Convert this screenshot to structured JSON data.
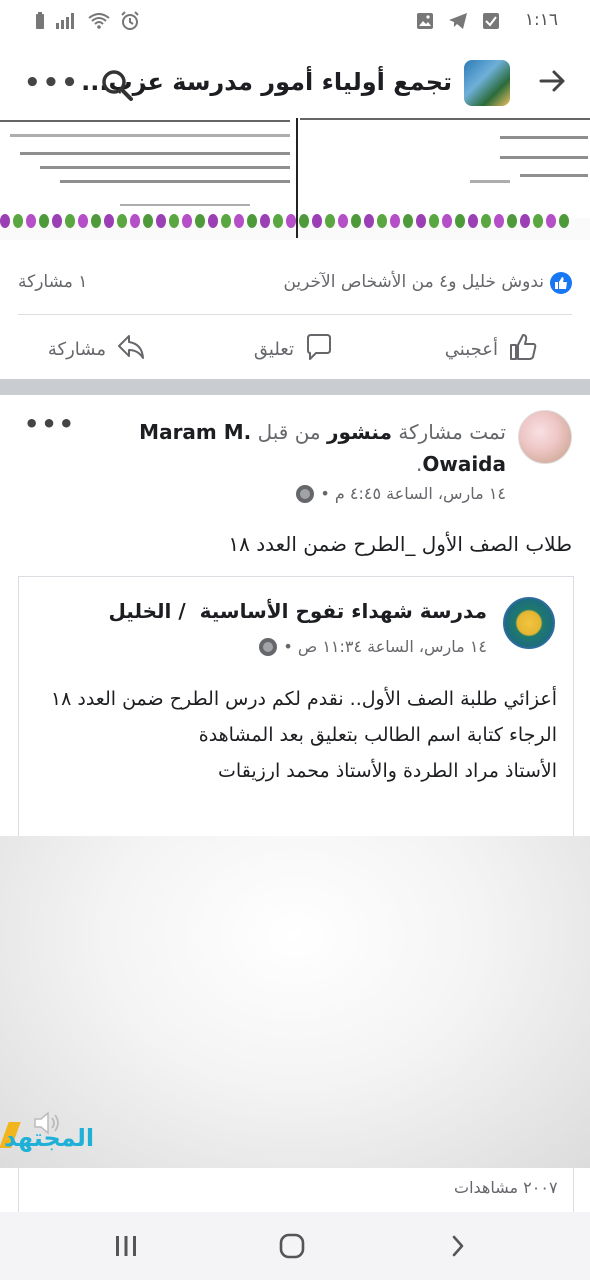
{
  "status_bar": {
    "time": "١:١٦",
    "left_icons": [
      "battery-icon",
      "signal-icon",
      "wifi-icon",
      "alarm-icon"
    ],
    "right_icons": [
      "checkbox-icon",
      "telegram-icon",
      "image-icon"
    ]
  },
  "header": {
    "title": "تجمع أولياء أمور مدرسة عزب...",
    "back_icon": "arrow-right-icon",
    "search_icon": "search-icon",
    "more_icon": "more-icon"
  },
  "previous_post": {
    "reactions_text": "ندوش خليل و٤ من الأشخاص الآخرين",
    "shares": "١ مشاركة",
    "actions": {
      "like": "أعجبني",
      "comment": "تعليق",
      "share": "مشاركة"
    }
  },
  "post": {
    "header_prefix": "تمت مشاركة",
    "header_post_word": "منشور",
    "header_by": "من قبل",
    "author": "Maram M. Owaida",
    "header_suffix": ".",
    "meta": "١٤ مارس، الساعة ٤:٤٥ م •",
    "body": "طلاب الصف الأول _الطرح ضمن العدد ١٨",
    "shared": {
      "page_name": "مدرسة شهداء تفوح الأساسية  / الخليل",
      "meta": "١٤ مارس، الساعة ١١:٣٤ ص •",
      "lines": [
        "أعزائي طلبة الصف الأول.. نقدم لكم درس الطرح ضمن العدد ١٨",
        "الرجاء كتابة اسم الطالب بتعليق بعد المشاهدة",
        "الأستاذ مراد الطردة والأستاذ محمد ارزيقات"
      ],
      "views": "٢٠٠٧ مشاهدات",
      "video_logo": "المجتهد"
    }
  },
  "colors": {
    "facebook_blue": "#1877f2",
    "secondary_text": "#65676b",
    "separator": "#c9ccd1"
  }
}
